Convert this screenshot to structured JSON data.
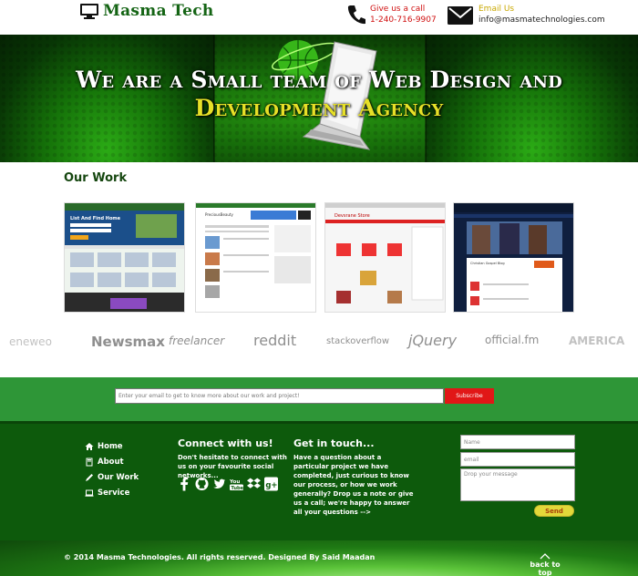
{
  "header": {
    "logo_text": "Masma Tech",
    "call_label": "Give us a call",
    "call_value": "1-240-716-9907",
    "email_label": "Email Us",
    "email_value": "info@masmatechnologies.com"
  },
  "hero": {
    "line1": "We are a Small team of Web Design and",
    "line2": "Development Agency"
  },
  "our_work": {
    "title": "Our Work",
    "items": [
      {
        "name": "List And Find Home"
      },
      {
        "name": "PreciousBeauty"
      },
      {
        "name": "Devsrane Store"
      },
      {
        "name": "Christian Gospel Blog"
      }
    ]
  },
  "clients": [
    "eneweo",
    "Newsmax",
    "freelancer",
    "reddit",
    "stackoverflow",
    "jQuery",
    "official.fm",
    "AMERICA"
  ],
  "newsletter": {
    "placeholder": "Enter your email to get to know more about our work and project!",
    "button": "Subscribe"
  },
  "footer": {
    "nav": [
      "Home",
      "About",
      "Our Work",
      "Service"
    ],
    "connect_title": "Connect with us!",
    "connect_text": "Don't hesitate to connect with us on your favourite social networks...",
    "touch_title": "Get in touch...",
    "touch_text": "Have a question about a particular project we have completed, just curious to know our process, or how we work generally? Drop us a note or give us a call; we're happy to answer all your questions -->",
    "form": {
      "name_placeholder": "Name",
      "email_placeholder": "email",
      "message_placeholder": "Drop your message",
      "send": "Send"
    },
    "copyright": "© 2014 Masma Technologies. All rights reserved. Designed By Said Maadan",
    "back_to_top": "back to top"
  },
  "colors": {
    "brand_green": "#146414",
    "hero_yellow": "#e7e027",
    "footer_green": "#0d5a0c",
    "newsletter_green": "#2e9637",
    "subscribe_red": "#e11717"
  }
}
